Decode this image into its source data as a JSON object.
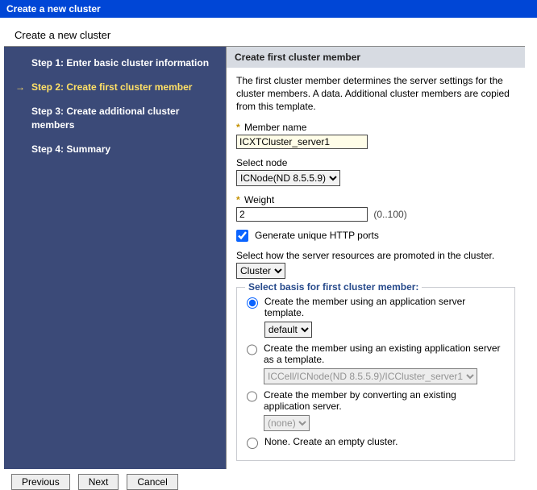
{
  "titleBar": "Create a new cluster",
  "pageHeading": "Create a new cluster",
  "sidebar": {
    "steps": [
      {
        "label": "Step 1: Enter basic cluster information"
      },
      {
        "label": "Step 2: Create first cluster member"
      },
      {
        "label": "Step 3: Create additional cluster members"
      },
      {
        "label": "Step 4: Summary"
      }
    ],
    "currentIndex": 1,
    "arrow": "→"
  },
  "main": {
    "header": "Create first cluster member",
    "intro": "The first cluster member determines the server settings for the cluster members. A data. Additional cluster members are copied from this template.",
    "fields": {
      "memberNameLabel": "Member name",
      "memberNameValue": "ICXTCluster_server1",
      "selectNodeLabel": "Select node",
      "selectNodeValue": "ICNode(ND 8.5.5.9)",
      "weightLabel": "Weight",
      "weightValue": "2",
      "weightRange": "(0..100)",
      "generatePortsLabel": "Generate unique HTTP ports",
      "generatePortsChecked": true,
      "promoteLabel": "Select how the server resources are promoted in the cluster.",
      "promoteValue": "Cluster"
    },
    "basis": {
      "title": "Select basis for first cluster member:",
      "options": [
        {
          "label": "Create the member using an application server template.",
          "selectValue": "default",
          "selectEnabled": true
        },
        {
          "label": "Create the member using an existing application server as a template.",
          "selectValue": "ICCell/ICNode(ND 8.5.5.9)/ICCluster_server1",
          "selectEnabled": false
        },
        {
          "label": "Create the member by converting an existing application server.",
          "selectValue": "(none)",
          "selectEnabled": false
        },
        {
          "label": "None. Create an empty cluster."
        }
      ],
      "selectedIndex": 0
    }
  },
  "buttons": {
    "previous": "Previous",
    "next": "Next",
    "cancel": "Cancel"
  },
  "reqMarker": "*"
}
